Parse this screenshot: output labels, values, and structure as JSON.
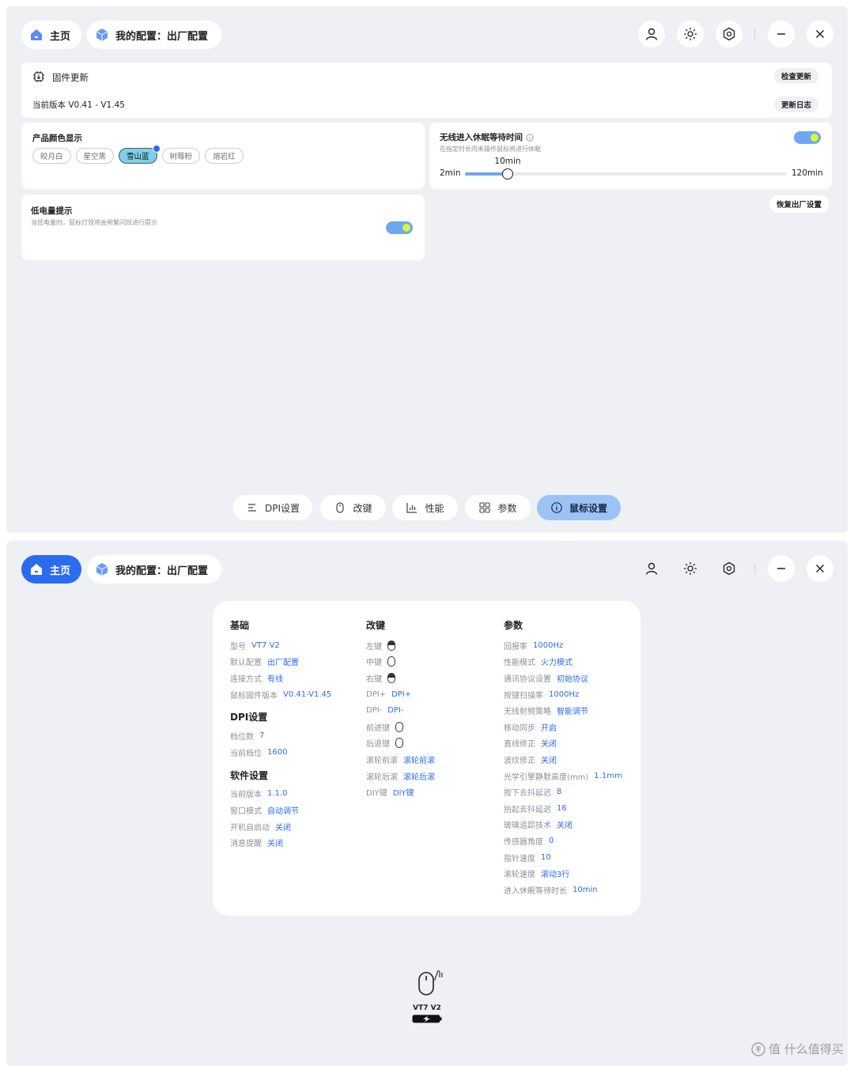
{
  "colors": {
    "accent": "#2b6bef",
    "panel_bg": "#eef0f3",
    "toggle_on": "#6fa6f0",
    "toggle_knob": "#d8f53a",
    "selected_color_chip": "#7fd0e6"
  },
  "titlebar": {
    "home_label": "主页",
    "config_label": "我的配置：出厂配置",
    "icons": [
      "user-icon",
      "brightness-icon",
      "hexagon-settings-icon",
      "minimize-icon",
      "close-icon"
    ]
  },
  "firmware": {
    "title": "固件更新",
    "current_version": "当前版本 V0.41 - V1.45",
    "check_update": "检查更新",
    "changelog": "更新日志"
  },
  "color_display": {
    "title": "产品颜色显示",
    "options": [
      "皎月白",
      "星空黑",
      "雪山蓝",
      "树莓粉",
      "熔岩红"
    ],
    "selected": "雪山蓝"
  },
  "sleep": {
    "title": "无线进入休眠等待时间",
    "desc": "在指定时长内未操作鼠标将进行休眠",
    "min_label": "2min",
    "max_label": "120min",
    "value_label": "10min",
    "min": 2,
    "max": 120,
    "value": 10,
    "enabled": true
  },
  "reset": {
    "label": "恢复出厂设置"
  },
  "low_battery": {
    "title": "低电量提示",
    "desc": "当低电量时，鼠标灯效将会频繁闪烁进行提示",
    "enabled": true
  },
  "tabs": [
    {
      "label": "DPI设置",
      "icon": "list-icon"
    },
    {
      "label": "改键",
      "icon": "mouse-icon"
    },
    {
      "label": "性能",
      "icon": "chart-icon"
    },
    {
      "label": "参数",
      "icon": "grid-icon"
    },
    {
      "label": "鼠标设置",
      "icon": "info-icon"
    }
  ],
  "summary": {
    "basic": {
      "title": "基础",
      "rows": [
        {
          "k": "型号",
          "v": "VT7 V2"
        },
        {
          "k": "默认配置",
          "v": "出厂配置"
        },
        {
          "k": "连接方式",
          "v": "有线"
        },
        {
          "k": "鼠标固件版本",
          "v": "V0.41-V1.45"
        }
      ]
    },
    "dpi": {
      "title": "DPI设置",
      "rows": [
        {
          "k": "档位数",
          "v": "7"
        },
        {
          "k": "当前档位",
          "v": "1600"
        }
      ]
    },
    "software": {
      "title": "软件设置",
      "rows": [
        {
          "k": "当前版本",
          "v": "1.1.0"
        },
        {
          "k": "窗口模式",
          "v": "自动调节"
        },
        {
          "k": "开机自启动",
          "v": "关闭"
        },
        {
          "k": "消息提醒",
          "v": "关闭"
        }
      ]
    },
    "keys": {
      "title": "改键",
      "rows": [
        {
          "k": "左键",
          "icon": "mouse-left-icon"
        },
        {
          "k": "中键",
          "icon": "mouse-middle-icon"
        },
        {
          "k": "右键",
          "icon": "mouse-right-icon"
        },
        {
          "k": "DPI+",
          "v": "DPI+"
        },
        {
          "k": "DPI-",
          "v": "DPI-"
        },
        {
          "k": "前进键",
          "icon": "mouse-forward-icon"
        },
        {
          "k": "后退键",
          "icon": "mouse-back-icon"
        },
        {
          "k": "滚轮前滚",
          "v": "滚轮前滚"
        },
        {
          "k": "滚轮后滚",
          "v": "滚轮后滚"
        },
        {
          "k": "DIY键",
          "v": "DIY键"
        }
      ]
    },
    "params": {
      "title": "参数",
      "rows": [
        {
          "k": "回报率",
          "v": "1000Hz"
        },
        {
          "k": "性能模式",
          "v": "火力模式"
        },
        {
          "k": "通讯协议设置",
          "v": "初始协议"
        },
        {
          "k": "按键扫描率",
          "v": "1000Hz"
        },
        {
          "k": "无线射频策略",
          "v": "智能调节"
        },
        {
          "k": "移动同步",
          "v": "开启"
        },
        {
          "k": "直线修正",
          "v": "关闭"
        },
        {
          "k": "波纹修正",
          "v": "关闭"
        },
        {
          "k": "光学引擎静默高度(mm)",
          "v": "1.1mm"
        },
        {
          "k": "按下去抖延迟",
          "v": "8"
        },
        {
          "k": "抬起去抖延迟",
          "v": "16"
        },
        {
          "k": "玻璃追踪技术",
          "v": "关闭"
        },
        {
          "k": "传感器角度",
          "v": "0"
        },
        {
          "k": "指针速度",
          "v": "10"
        },
        {
          "k": "滚轮速度",
          "v": "滚动3行"
        },
        {
          "k": "进入休眠等待时长",
          "v": "10min"
        }
      ]
    }
  },
  "device": {
    "name": "VT7 V2",
    "connection_icon": "wired-icon",
    "battery_icon": "battery-charging-icon"
  },
  "watermark": "值 什么值得买"
}
